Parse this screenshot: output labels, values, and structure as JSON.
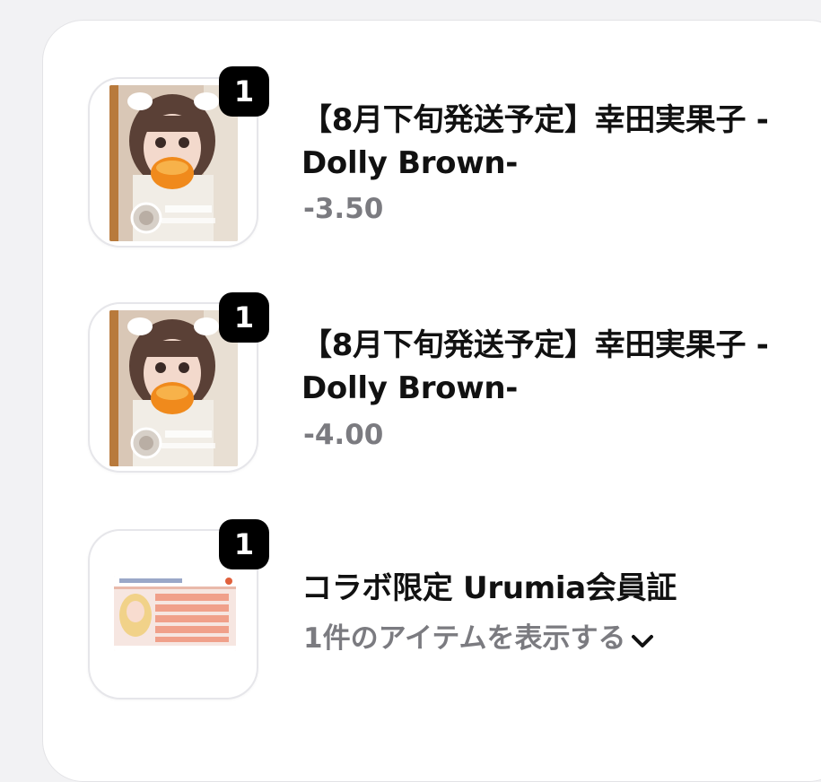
{
  "items": [
    {
      "badge": "1",
      "title": "【8月下旬発送予定】幸田実果子 -Dolly Brown-",
      "subtitle": "-3.50",
      "image": "contact-lens-product-photo"
    },
    {
      "badge": "1",
      "title": "【8月下旬発送予定】幸田実果子 -Dolly Brown-",
      "subtitle": "-4.00",
      "image": "contact-lens-product-photo"
    },
    {
      "badge": "1",
      "title": "コラボ限定 Urumia会員証",
      "subtitle": "1件のアイテムを表示する",
      "image": "membership-card-photo",
      "expand_icon": "chevron-down-icon"
    }
  ],
  "colors": {
    "badge_bg": "#000000",
    "title": "#111111",
    "subtitle": "#7b7b80",
    "panel_bg": "#ffffff",
    "page_bg": "#f2f2f4"
  }
}
